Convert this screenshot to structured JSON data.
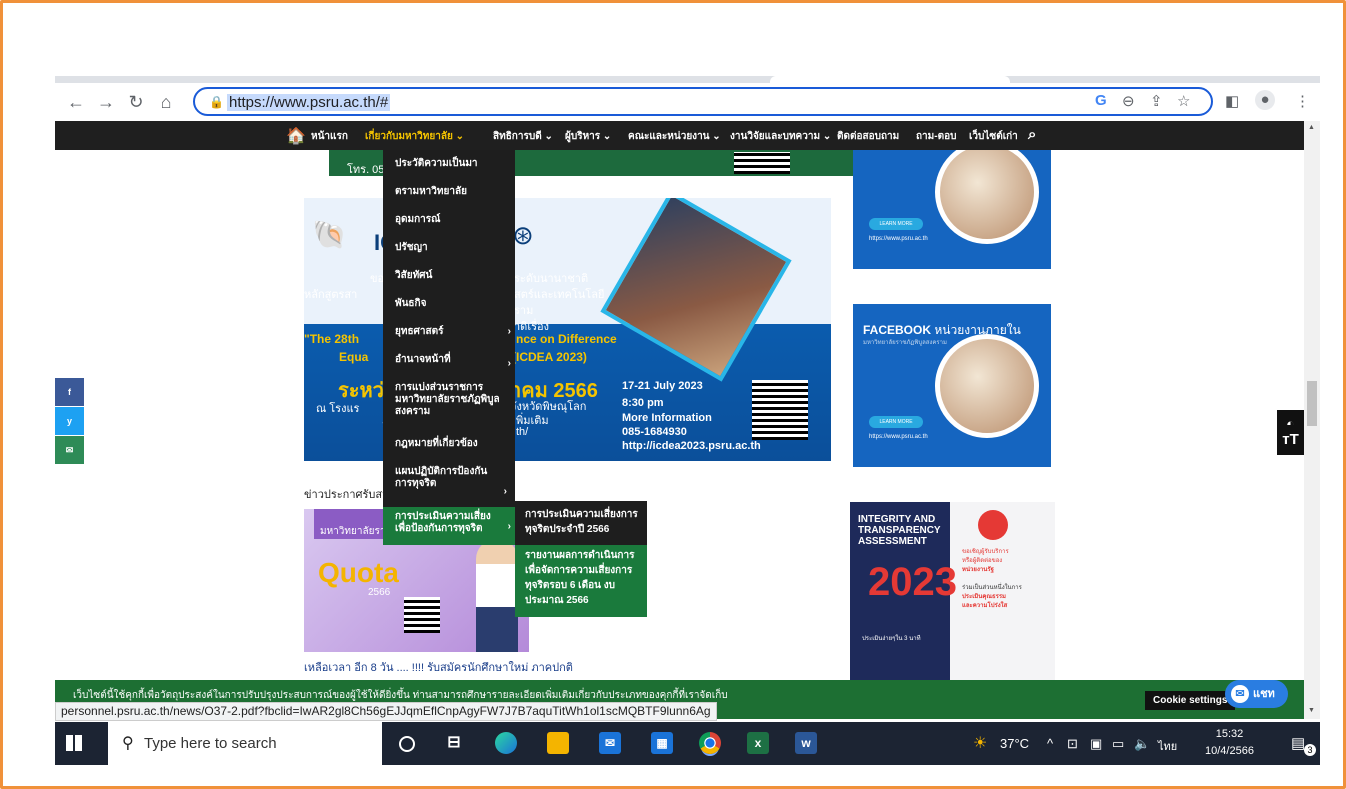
{
  "browser": {
    "url": "https://www.psru.ac.th/#",
    "status_url": "personnel.psru.ac.th/news/O37-2.pdf?fbclid=IwAR2gl8Ch56gEJJqmEflCnpAgyFW7J7B7aquTitWh1ol1scMQBTF9lunn6Ag"
  },
  "nav": {
    "items": [
      "หน้าแรก",
      "เกี่ยวกับมหาวิทยาลัย ⌄",
      "สิทธิการบดี ⌄",
      "ผู้บริหาร ⌄",
      "คณะและหน่วยงาน ⌄",
      "งานวิจัยและบทความ ⌄",
      "ติดต่อสอบถาม",
      "ถาม-ตอบ",
      "เว็บไซต์เก่า"
    ]
  },
  "dropdown": {
    "items": [
      {
        "label": "ประวัติความเป็นมา"
      },
      {
        "label": "ตรามหาวิทยาลัย"
      },
      {
        "label": "อุดมการณ์"
      },
      {
        "label": "ปรัชญา"
      },
      {
        "label": "วิสัยทัศน์"
      },
      {
        "label": "พันธกิจ"
      },
      {
        "label": "ยุทธศาสตร์"
      },
      {
        "label": "อำนาจหน้าที่"
      },
      {
        "label": "การแบ่งส่วนราชการมหาวิทยาลัยราชภัฏพิบูลสงคราม"
      },
      {
        "label": "กฎหมายที่เกี่ยวข้อง"
      },
      {
        "label": "แผนปฏิบัติการป้องกันการทุจริต"
      },
      {
        "label": "การประเมินความเสี่ยงเพื่อป้องกันการทุจริต"
      }
    ],
    "submenu": [
      {
        "label": "การประเมินความเสี่ยงการทุจริตประจำปี 2566"
      },
      {
        "label": "รายงานผลการดำเนินการเพื่อจัดการความเสี่ยงการทุจริตรอบ 6 เดือน งบประมาณ 2566"
      }
    ]
  },
  "content": {
    "greenbox_text": "โทร. 055",
    "banner": {
      "logo_text": "IC",
      "line1": "ขอเชิญ",
      "line1b": "ระดับนานาชาติ",
      "line2": "หลักสูตรสา",
      "line2b": "สตร์และเทคโนโลยี",
      "line3": "ราม",
      "line4": "จ",
      "line4b": "าดิเรื่อง",
      "title_a": "\"The 28th",
      "title_b": "nce on Difference",
      "title_c": "Equa",
      "title_d": "(ICDEA 2023)",
      "date_a": "ระหว่า",
      "date_b": "าคม 2566",
      "venue_a": "ณ โรงแร",
      "venue_b": "จังหวัดพิษณุโลก",
      "more_a": "ส",
      "more_b": "พิ่มเติม",
      "path": "th/",
      "date_range": "17-21 July 2023",
      "time": "8:30 pm",
      "more_info": "More Information",
      "phone": "085-1684930",
      "site": "http://icdea2023.psru.ac.th"
    },
    "card1": {
      "learn": "LEARN MORE",
      "url": "https://www.psru.ac.th"
    },
    "card2": {
      "title_en": "FACEBOOK",
      "title_th": "หน่วยงานภายใน",
      "subtitle": "มหาวิทยาลัยราชภัฏพิบูลสงคราม",
      "learn": "LEARN MORE",
      "url": "https://www.psru.ac.th"
    },
    "ita": {
      "title": "INTEGRITY AND TRANSPARENCY ASSESSMENT",
      "year": "2023",
      "pill": "ประเมินง่ายๆใน 3 นาที",
      "r1": "ขอเชิญผู้รับบริการ",
      "r2": "หรือผู้ติดต่อของ",
      "r3": "หน่วยงานรัฐ",
      "r4": "ร่วมเป็นส่วนหนึ่งในการ",
      "r5": "ประเมินคุณธรรม",
      "r6": "และความโปร่งใส"
    },
    "section_label": "ข่าวประกาศรับสม",
    "quota": {
      "head": "มหาวิทยาลัยรา",
      "big": "Quota",
      "sub": "2566"
    },
    "headline": "เหลือเวลา อีก 8 วัน .... !!!! รับสมัครนักศึกษาใหม่ ภาคปกติ"
  },
  "share": [
    {
      "label": "f",
      "color": "#3b5998"
    },
    {
      "label": "y",
      "color": "#1da1f2"
    },
    {
      "label": "✉",
      "color": "#2e8b57"
    }
  ],
  "cookie": {
    "text": "เว็บไซต์นี้ใช้คุกกี้เพื่อวัตถุประสงค์ในการปรับปรุงประสบการณ์ของผู้ใช้ให้ดียิ่งขึ้น ท่านสามารถศึกษารายละเอียดเพิ่มเติมเกี่ยวกับประเภทของคุกกี้ที่เราจัดเก็บ",
    "settings": "Cookie settings",
    "chat": "แชท"
  },
  "taskbar": {
    "search_placeholder": "Type here to search",
    "temp": "37°C",
    "lang": "ไทย",
    "time": "15:32",
    "date": "10/4/2566",
    "notif_count": "3"
  }
}
